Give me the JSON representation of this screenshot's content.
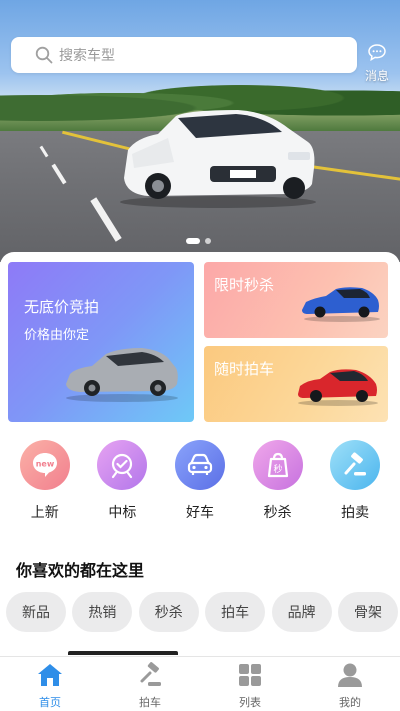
{
  "search": {
    "placeholder": "搜索车型"
  },
  "header": {
    "message_label": "消息"
  },
  "banner": {
    "dot_count": 2,
    "active_dot": 0
  },
  "promos": {
    "auction": {
      "title": "无底价竞拍",
      "subtitle": "价格由你定"
    },
    "flash": {
      "title": "限时秒杀"
    },
    "anytime": {
      "title": "随时拍车"
    }
  },
  "categories": [
    {
      "label": "上新",
      "icon": "new-icon",
      "color": "#f58b8b"
    },
    {
      "label": "中标",
      "icon": "target-icon",
      "color": "#c97ce8"
    },
    {
      "label": "好车",
      "icon": "car-icon",
      "color": "#6d86f2"
    },
    {
      "label": "秒杀",
      "icon": "flash-sale-icon",
      "color": "#d77fde"
    },
    {
      "label": "拍卖",
      "icon": "gavel-icon",
      "color": "#58c6f0"
    }
  ],
  "section": {
    "title": "你喜欢的都在这里"
  },
  "tags": [
    "新品",
    "热销",
    "秒杀",
    "拍车",
    "品牌",
    "骨架"
  ],
  "nav": [
    {
      "label": "首页",
      "icon": "home-icon",
      "active": true
    },
    {
      "label": "拍车",
      "icon": "gavel-icon",
      "active": false
    },
    {
      "label": "列表",
      "icon": "grid-icon",
      "active": false
    },
    {
      "label": "我的",
      "icon": "user-icon",
      "active": false
    }
  ],
  "colors": {
    "accent": "#2f8ee8"
  }
}
